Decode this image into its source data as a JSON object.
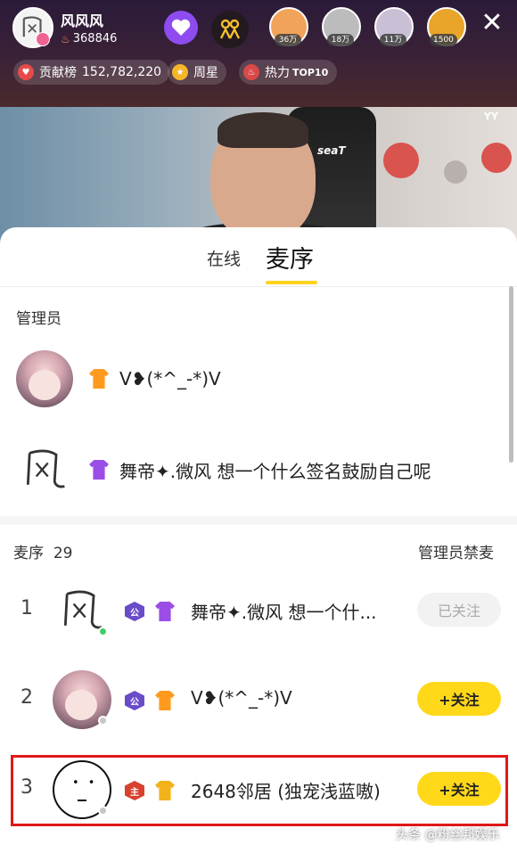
{
  "host": {
    "name": "风风风",
    "fans": "368846"
  },
  "viewers": [
    {
      "count": "36万",
      "color": "#f2a35a"
    },
    {
      "count": "18万",
      "color": "#bcbcbc"
    },
    {
      "count": "11万",
      "color": "#c9c0d6"
    },
    {
      "count": "1500",
      "color": "#e9a42a"
    }
  ],
  "header_pills": {
    "contribution_label": "贡献榜",
    "contribution_value": "152,782,220",
    "weekly_star": "周星",
    "hot_label": "热力",
    "hot_rank": "TOP10"
  },
  "video": {
    "chair_brand": "seaT",
    "corner_mark": "YY"
  },
  "tabs": {
    "online": "在线",
    "queue": "麦序"
  },
  "admins": {
    "title": "管理员",
    "items": [
      {
        "name": "V❥(*^_-*)V",
        "badge": "shirt-orange"
      },
      {
        "name": "舞帝✦.微风 想一个什么签名鼓励自己呢",
        "badge": "shirt-purple"
      }
    ]
  },
  "queue": {
    "label": "麦序",
    "count": "29",
    "admin_ban": "管理员禁麦",
    "items": [
      {
        "rank": "1",
        "name": "舞帝✦.微风 想一个什...",
        "role_badge": "公",
        "follow": "已关注",
        "online": true
      },
      {
        "rank": "2",
        "name": "V❥(*^_-*)V",
        "role_badge": "公",
        "follow": "+关注",
        "online": false
      },
      {
        "rank": "3",
        "name": "2648邻居 (独宠浅蓝嗷)",
        "role_badge": "主",
        "follow": "+关注",
        "online": false
      }
    ]
  },
  "watermark": "头条 @粉丝邦娱乐",
  "colors": {
    "accent_yellow": "#ffd21f",
    "highlight_red": "#e01818",
    "online_green": "#3fcf6a"
  }
}
